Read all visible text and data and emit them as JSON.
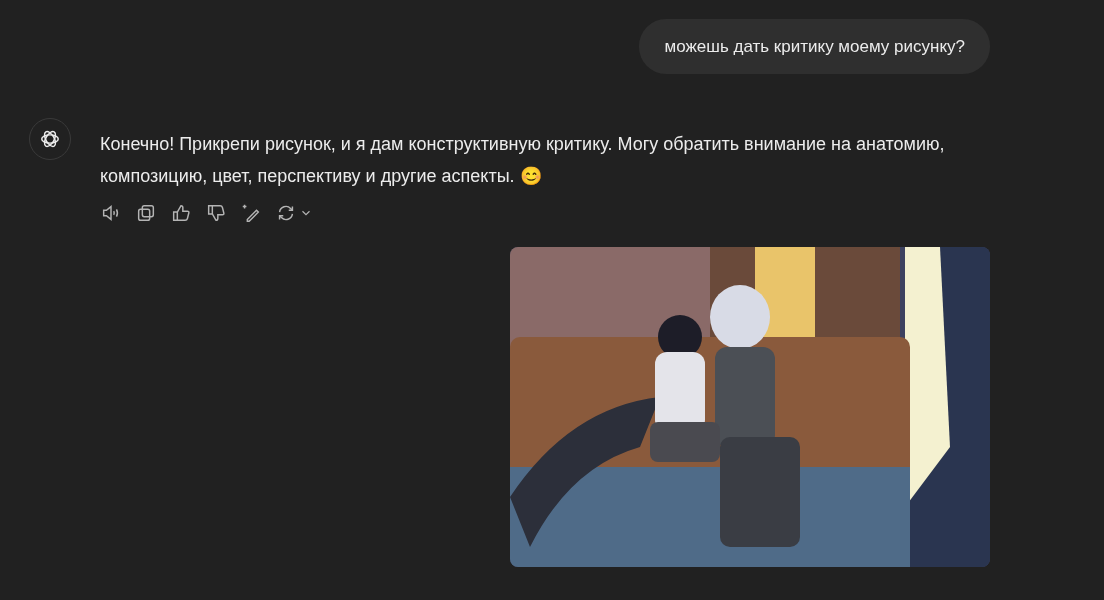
{
  "user_message": {
    "text": "можешь дать критику моему рисунку?"
  },
  "assistant_message": {
    "text": "Конечно! Прикрепи рисунок, и я дам конструктивную критику. Могу обратить внимание на анатомию, композицию, цвет, перспективу и другие аспекты. 😊"
  }
}
